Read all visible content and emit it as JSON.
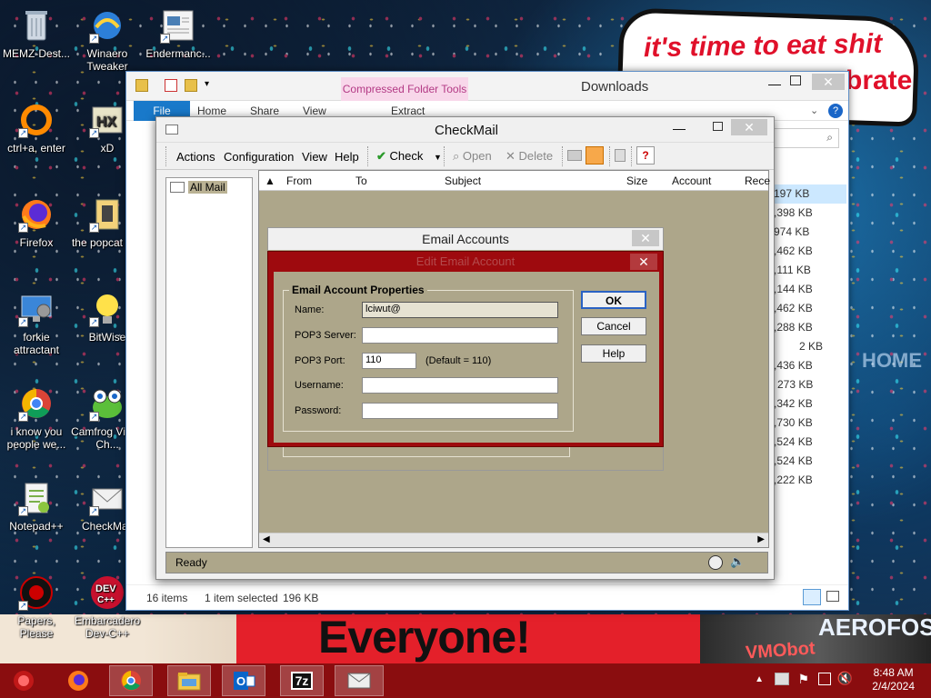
{
  "meme": {
    "speech_line1": "it's time to eat shit",
    "speech_line2": "brate",
    "banner": "Everyone!",
    "sign_right": "AEROFOS",
    "sign_vmo": "VMObot",
    "home": "HOME"
  },
  "desktop_icons": [
    {
      "label": "MEMZ-Dest...",
      "icon": "recycle-bin"
    },
    {
      "label": "Winaero Tweaker",
      "icon": "winaero"
    },
    {
      "label": "Endermanc...",
      "icon": "image-file"
    },
    {
      "label": "ctrl+a, enter",
      "icon": "ring"
    },
    {
      "label": "xD",
      "icon": "hxd"
    },
    {
      "label": "Firefox",
      "icon": "firefox"
    },
    {
      "label": "the popcat shit",
      "icon": "popcat"
    },
    {
      "label": "forkie attractant",
      "icon": "control-panel"
    },
    {
      "label": "BitWise",
      "icon": "lightbulb"
    },
    {
      "label": "i know you people we...",
      "icon": "chrome"
    },
    {
      "label": "Camfrog Video Ch...",
      "icon": "camfrog"
    },
    {
      "label": "Notepad++",
      "icon": "notepad-plus"
    },
    {
      "label": "CheckMail",
      "icon": "envelope"
    },
    {
      "label": "Papers, Please",
      "icon": "papers-please"
    },
    {
      "label": "Embarcadero Dev-C++",
      "icon": "dev-cpp"
    }
  ],
  "explorer": {
    "title": "Downloads",
    "context_tab": "Compressed Folder Tools",
    "tabs": [
      "File",
      "Home",
      "Share",
      "View"
    ],
    "context_subtab": "Extract",
    "sizes": [
      "197 KB",
      ",398 KB",
      "974 KB",
      ",462 KB",
      ",111 KB",
      ",144 KB",
      ",462 KB",
      ",288 KB",
      "2 KB",
      ",436 KB",
      "273 KB",
      ",342 KB",
      ",730 KB",
      ",524 KB",
      ",524 KB",
      ",222 KB"
    ],
    "status": {
      "items": "16 items",
      "selected": "1 item selected",
      "size": "196 KB"
    }
  },
  "checkmail": {
    "title": "CheckMail",
    "menu": [
      "Actions",
      "Configuration",
      "View",
      "Help"
    ],
    "toolbar": {
      "check": "Check",
      "open": "Open",
      "delete": "Delete"
    },
    "tree_item": "All Mail",
    "columns": [
      "From",
      "To",
      "Subject",
      "Size",
      "Account",
      "Rece"
    ],
    "status": "Ready"
  },
  "accounts_dialog": {
    "title": "Email Accounts"
  },
  "edit_dialog": {
    "title": "Edit Email Account",
    "group_title": "Email Account Properties",
    "labels": {
      "name": "Name:",
      "pop3_server": "POP3 Server:",
      "pop3_port": "POP3 Port:",
      "username": "Username:",
      "password": "Password:"
    },
    "values": {
      "name": "lciwut@",
      "pop3_server": "",
      "pop3_port": "110",
      "username": "",
      "password": ""
    },
    "port_hint": "(Default = 110)",
    "buttons": {
      "ok": "OK",
      "cancel": "Cancel",
      "help": "Help"
    }
  },
  "taskbar": {
    "apps": [
      "firefox",
      "chrome",
      "file-explorer",
      "outlook",
      "7zip",
      "checkmail"
    ],
    "app_7z_label": "7z",
    "time": "8:48 AM",
    "date": "2/4/2024"
  }
}
